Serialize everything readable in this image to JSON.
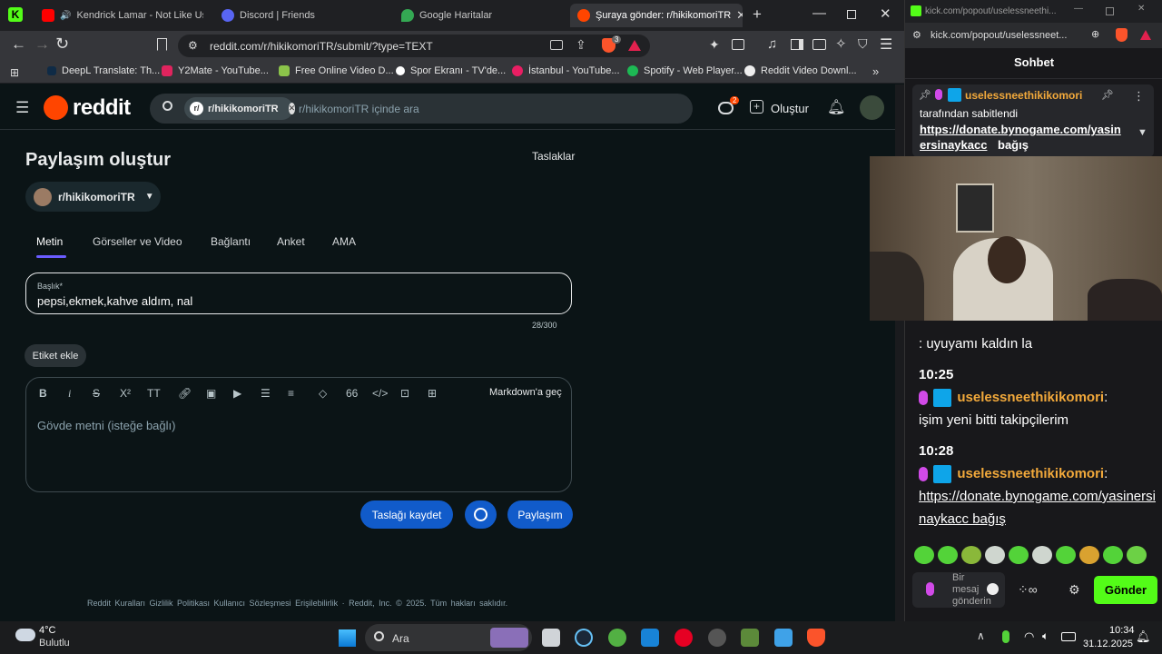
{
  "browser": {
    "tabs": [
      {
        "title": "Kendrick Lamar - Not Like Us -",
        "active": false
      },
      {
        "title": "Discord | Friends",
        "active": false
      },
      {
        "title": "Google Haritalar",
        "active": false
      },
      {
        "title": "Şuraya gönder: r/hikikomoriTR",
        "active": true
      }
    ],
    "url": "reddit.com/r/hikikomoriTR/submit/?type=TEXT",
    "brave_badge": "3",
    "bookmarks": [
      "DeepL Translate: Th...",
      "Y2Mate - YouTube...",
      "Free Online Video D...",
      "Spor Ekranı - TV'de...",
      "İstanbul - YouTube...",
      "Spotify - Web Player...",
      "Reddit Video Downl..."
    ]
  },
  "reddit": {
    "logo": "reddit",
    "search": {
      "chip": "r/hikikomoriTR",
      "placeholder": "r/hikikomoriTR içinde ara"
    },
    "chat_badge": "2",
    "create_label": "Oluştur",
    "page_title": "Paylaşım oluştur",
    "drafts_label": "Taslaklar",
    "community": "r/hikikomoriTR",
    "post_tabs": [
      "Metin",
      "Görseller ve Video",
      "Bağlantı",
      "Anket",
      "AMA"
    ],
    "active_tab": "Metin",
    "title_label": "Başlık*",
    "title_value": "pepsi,ekmek,kahve aldım, nal",
    "title_counter": "28/300",
    "tag_button": "Etiket ekle",
    "markdown_button": "Markdown'a geç",
    "body_placeholder": "Gövde metni (isteğe bağlı)",
    "save_draft": "Taslağı kaydet",
    "post_button": "Paylaşım",
    "footer": "Reddit Kuralları   Gizlilik Politikası   Kullanıcı Sözleşmesi   Erişilebilirlik   ·   Reddit, Inc. © 2025. Tüm hakları saklıdır."
  },
  "kick": {
    "window_title": "kick.com/popout/uselessneethi...",
    "url": "kick.com/popout/uselessneet...",
    "chat_header": "Sohbet",
    "pinned": {
      "user": "uselessneethikikomori",
      "pinned_by": "tarafından sabitlendi",
      "link": "https://donate.bynogame.com/yasinersinaykacc",
      "suffix": "bağış"
    },
    "messages": [
      {
        "time": "",
        "user": "",
        "text": ": uyuyamı kaldın la"
      },
      {
        "time": "10:25",
        "user": "uselessneethikikomori",
        "text": "işim yeni bitti takipçilerim"
      },
      {
        "time": "10:28",
        "user": "uselessneethikikomori",
        "text": "https://donate.bynogame.com/yasinersinaykacc bağış"
      }
    ],
    "input_placeholder": "Bir mesaj gönderin",
    "send_label": "Gönder"
  },
  "taskbar": {
    "weather_temp": "4°C",
    "weather_desc": "Bulutlu",
    "search_label": "Ara",
    "time": "10:34",
    "date": "31.12.2025"
  },
  "colors": {
    "reddit_orange": "#ff4500",
    "reddit_blue": "#115bca",
    "kick_green": "#53fc18",
    "username_gold": "#f2a93b"
  }
}
